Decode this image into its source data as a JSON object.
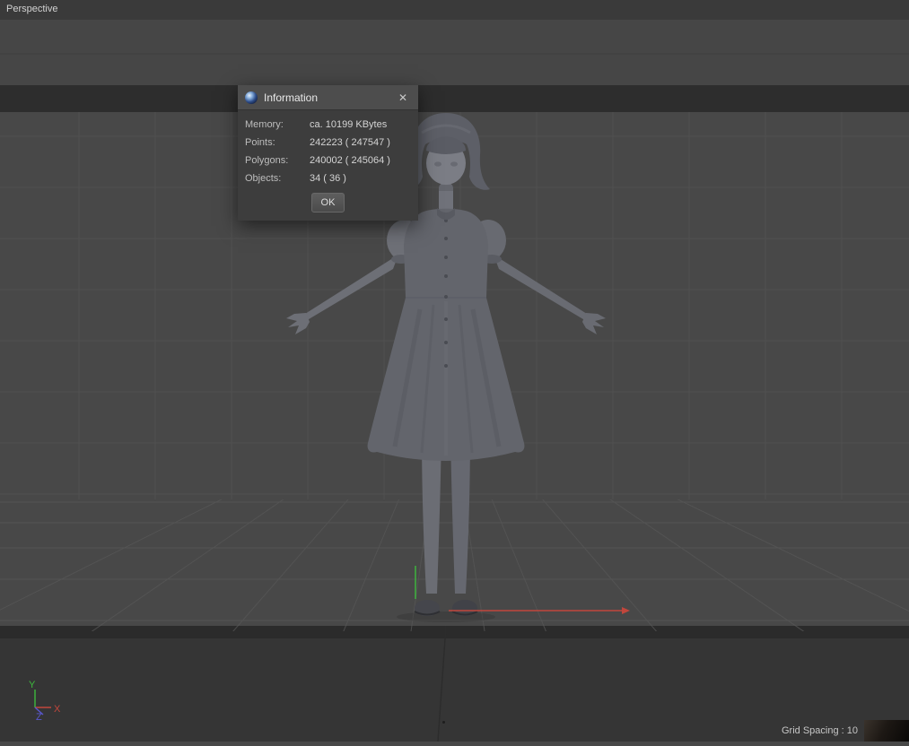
{
  "viewport": {
    "label": "Perspective",
    "grid_spacing_label": "Grid Spacing : 10",
    "axis_gizmo": {
      "x": "X",
      "y": "Y",
      "z": "Z"
    }
  },
  "colors": {
    "axis_x": "#c1463c",
    "axis_y": "#3dbb3d",
    "axis_z": "#5957cf",
    "viewport_bg": "#484848"
  },
  "dialog": {
    "title": "Information",
    "close_icon": "✕",
    "rows": [
      {
        "label": "Memory:",
        "value": "ca. 10199 KBytes"
      },
      {
        "label": "Points:",
        "value": "242223 ( 247547 )"
      },
      {
        "label": "Polygons:",
        "value": "240002 ( 245064 )"
      },
      {
        "label": "Objects:",
        "value": "34 ( 36 )"
      }
    ],
    "ok_label": "OK"
  }
}
